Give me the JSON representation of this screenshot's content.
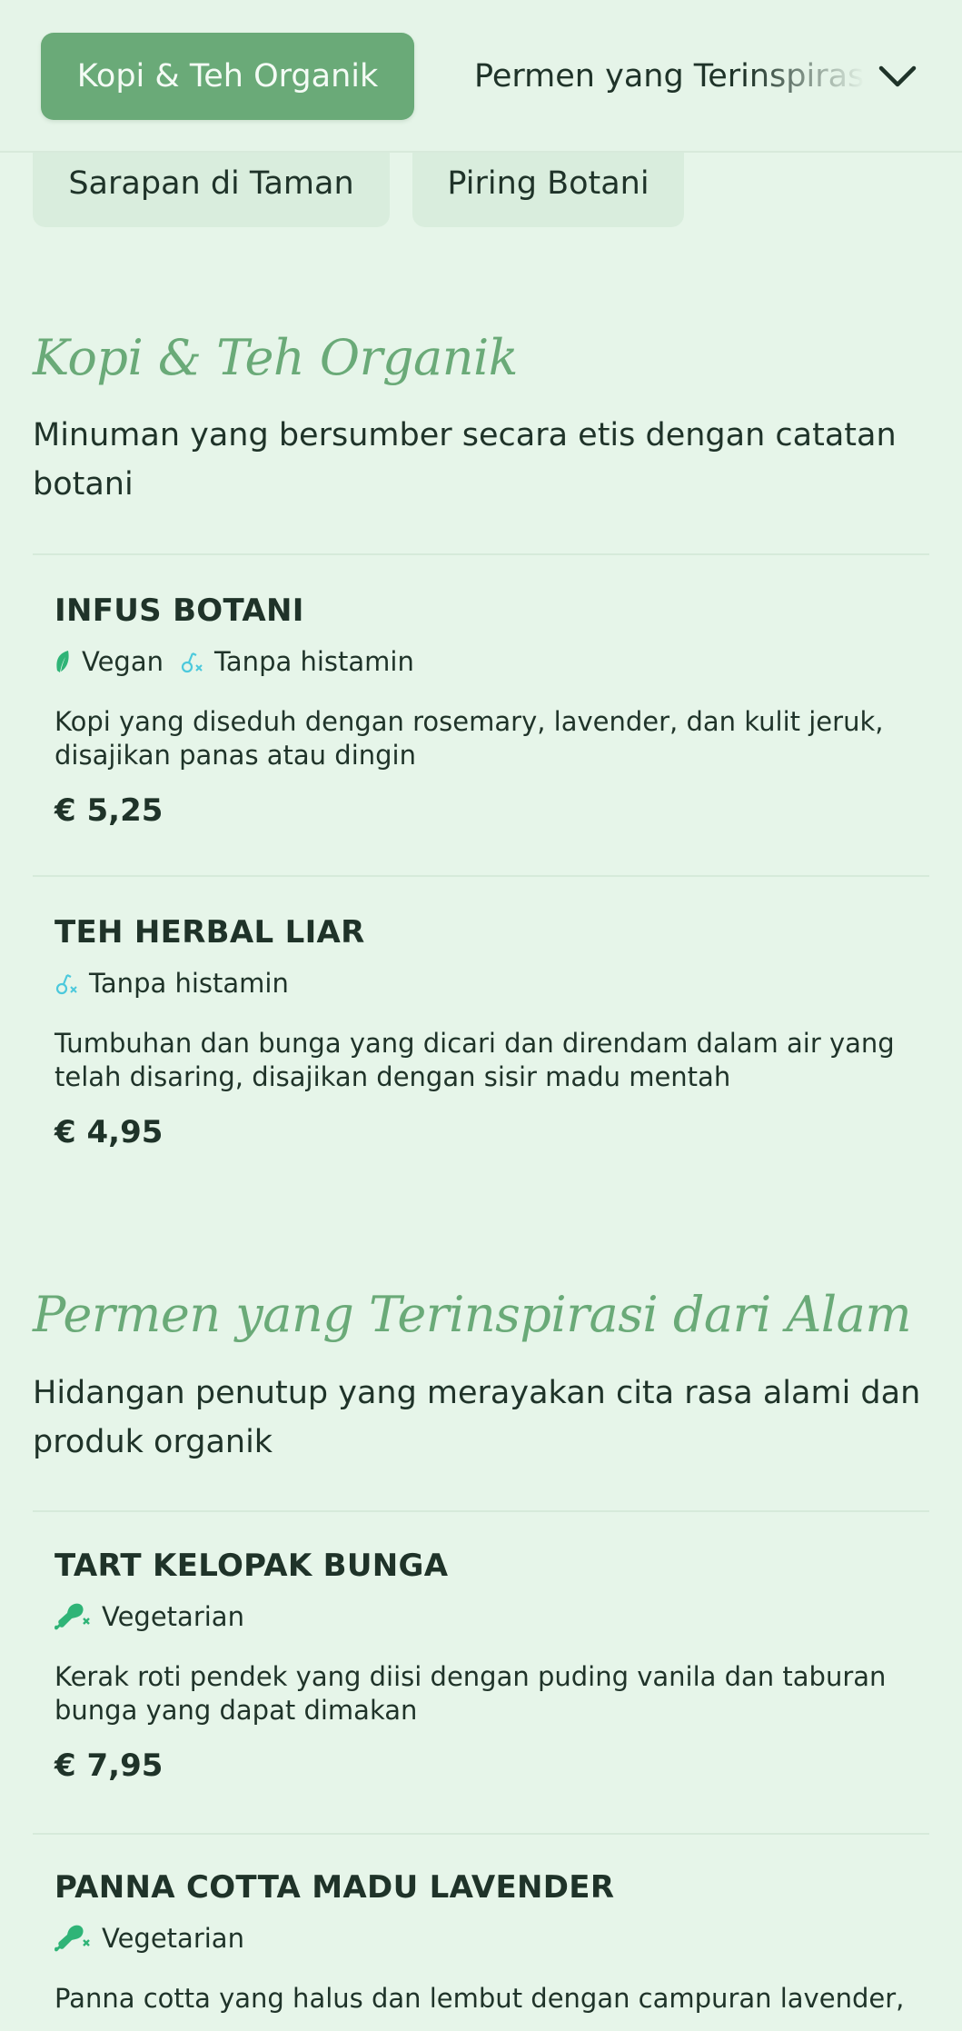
{
  "category_bar": {
    "active": "Kopi & Teh Organik",
    "next": "Permen yang Terinspirasi dari Alam",
    "row2": [
      "Sarapan di Taman",
      "Piring Botani"
    ]
  },
  "sections": [
    {
      "title": "Kopi & Teh Organik",
      "description": "Minuman yang bersumber secara etis dengan catatan botani",
      "items": [
        {
          "name": "INFUS BOTANI",
          "tags": [
            {
              "label": "Vegan",
              "icon": "leaf-icon"
            },
            {
              "label": "Tanpa histamin",
              "icon": "histamine-free-icon"
            }
          ],
          "description": "Kopi yang diseduh dengan rosemary, lavender, dan kulit jeruk, disajikan panas atau dingin",
          "price": "€ 5,25"
        },
        {
          "name": "TEH HERBAL LIAR",
          "tags": [
            {
              "label": "Tanpa histamin",
              "icon": "histamine-free-icon"
            }
          ],
          "description": "Tumbuhan dan bunga yang dicari dan direndam dalam air yang telah disaring, disajikan dengan sisir madu mentah",
          "price": "€ 4,95"
        }
      ]
    },
    {
      "title": "Permen yang Terinspirasi dari Alam",
      "description": "Hidangan penutup yang merayakan cita rasa alami dan produk organik",
      "items": [
        {
          "name": "TART KELOPAK BUNGA",
          "tags": [
            {
              "label": "Vegetarian",
              "icon": "no-meat-icon"
            }
          ],
          "description": "Kerak roti pendek yang diisi dengan puding vanila dan taburan bunga yang dapat dimakan",
          "price": "€ 7,95"
        },
        {
          "name": "PANNA COTTA MADU LAVENDER",
          "tags": [
            {
              "label": "Vegetarian",
              "icon": "no-meat-icon"
            }
          ],
          "description": "Panna cotta yang halus dan lembut dengan campuran lavender,"
        }
      ]
    }
  ],
  "colors": {
    "background": "#e6f5e9",
    "accent": "#6aaa78",
    "text": "#1f3329",
    "vegan_green": "#2fb477",
    "histamine_teal": "#4cc9dc"
  }
}
